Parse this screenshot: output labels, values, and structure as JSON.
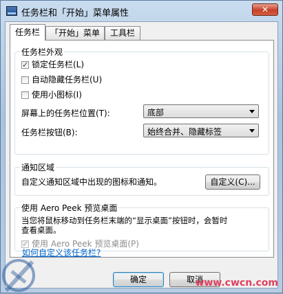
{
  "window": {
    "title": "任务栏和「开始」菜单属性",
    "close_glyph": "✕"
  },
  "tabs": [
    {
      "label": "任务栏"
    },
    {
      "label": "「开始」菜单"
    },
    {
      "label": "工具栏"
    }
  ],
  "appearance": {
    "legend": "任务栏外观",
    "lock": {
      "label": "锁定任务栏(L)",
      "checked": true
    },
    "autohide": {
      "label": "自动隐藏任务栏(U)",
      "checked": false
    },
    "small_icons": {
      "label": "使用小图标(I)",
      "checked": false
    },
    "location_label": "屏幕上的任务栏位置(T):",
    "location_value": "底部",
    "buttons_label": "任务栏按钮(B):",
    "buttons_value": "始终合并、隐藏标签"
  },
  "notification": {
    "legend": "通知区域",
    "desc": "自定义通知区域中出现的图标和通知。",
    "customize_button": "自定义(C)..."
  },
  "aero": {
    "legend": "使用 Aero Peek 预览桌面",
    "desc_line1": "当您将鼠标移动到任务栏末端的“显示桌面”按钮时，会暂时",
    "desc_line2": "查看桌面。",
    "checkbox": {
      "label": "使用 Aero Peek 预览桌面(P)",
      "checked": true,
      "disabled": true
    }
  },
  "help_link": "如何自定义该任务栏?",
  "buttons": {
    "ok": "确定",
    "cancel": "取消"
  },
  "watermark": {
    "right": "www.cwcn.com"
  }
}
